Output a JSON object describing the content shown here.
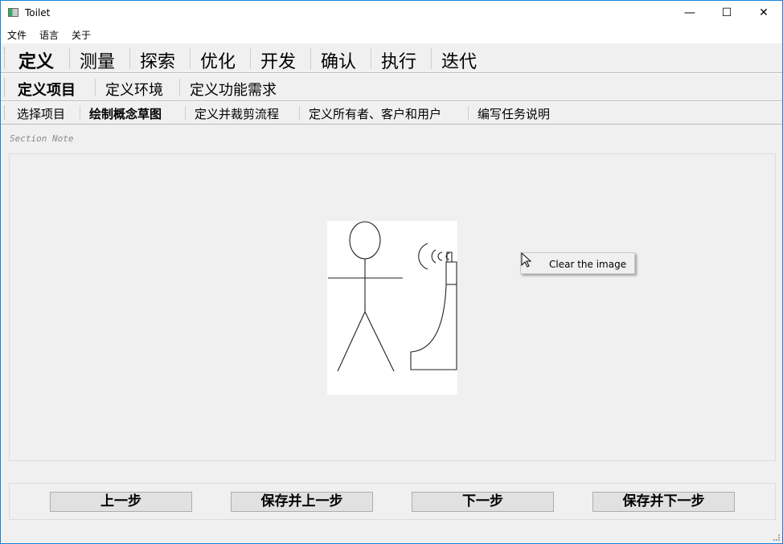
{
  "window": {
    "title": "Toilet",
    "minimize": "—",
    "maximize": "☐",
    "close": "✕"
  },
  "menu": [
    "文件",
    "语言",
    "关于"
  ],
  "phases": [
    "定义",
    "测量",
    "探索",
    "优化",
    "开发",
    "确认",
    "执行",
    "迭代"
  ],
  "subphases": [
    "定义项目",
    "定义环境",
    "定义功能需求"
  ],
  "steps": [
    "选择项目",
    "绘制概念草图",
    "定义并裁剪流程",
    "定义所有者、客户和用户",
    "编写任务说明"
  ],
  "section_note": "Section Note",
  "context_menu": {
    "item": "Clear the image"
  },
  "buttons": {
    "prev": "上一步",
    "save_prev": "保存并上一步",
    "next": "下一步",
    "save_next": "保存并下一步"
  }
}
